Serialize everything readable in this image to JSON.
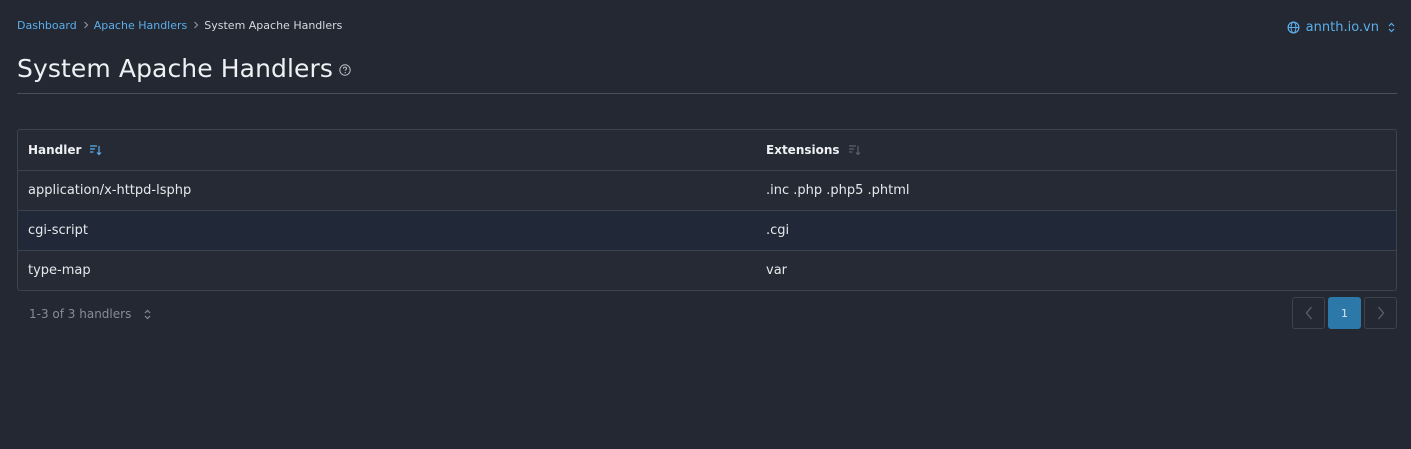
{
  "breadcrumb": {
    "items": [
      {
        "label": "Dashboard"
      },
      {
        "label": "Apache Handlers"
      }
    ],
    "current": "System Apache Handlers"
  },
  "domain_selector": {
    "value": "annth.io.vn",
    "icon": "globe-icon"
  },
  "page": {
    "title": "System Apache Handlers",
    "help_icon": "help-circle-icon"
  },
  "table": {
    "columns": [
      {
        "label": "Handler",
        "sort_icon": "sort-icon"
      },
      {
        "label": "Extensions",
        "sort_icon": "sort-icon"
      }
    ],
    "rows": [
      {
        "handler": "application/x-httpd-lsphp",
        "extensions": ".inc .php .php5 .phtml"
      },
      {
        "handler": "cgi-script",
        "extensions": ".cgi"
      },
      {
        "handler": "type-map",
        "extensions": "var"
      }
    ]
  },
  "footer": {
    "count_label": "1-3 of 3 handlers",
    "pagination": {
      "current_page": "1"
    }
  },
  "colors": {
    "background": "#242832",
    "link": "#5aaeea",
    "active_page": "#2c78a8",
    "highlight_row": "#212938"
  }
}
